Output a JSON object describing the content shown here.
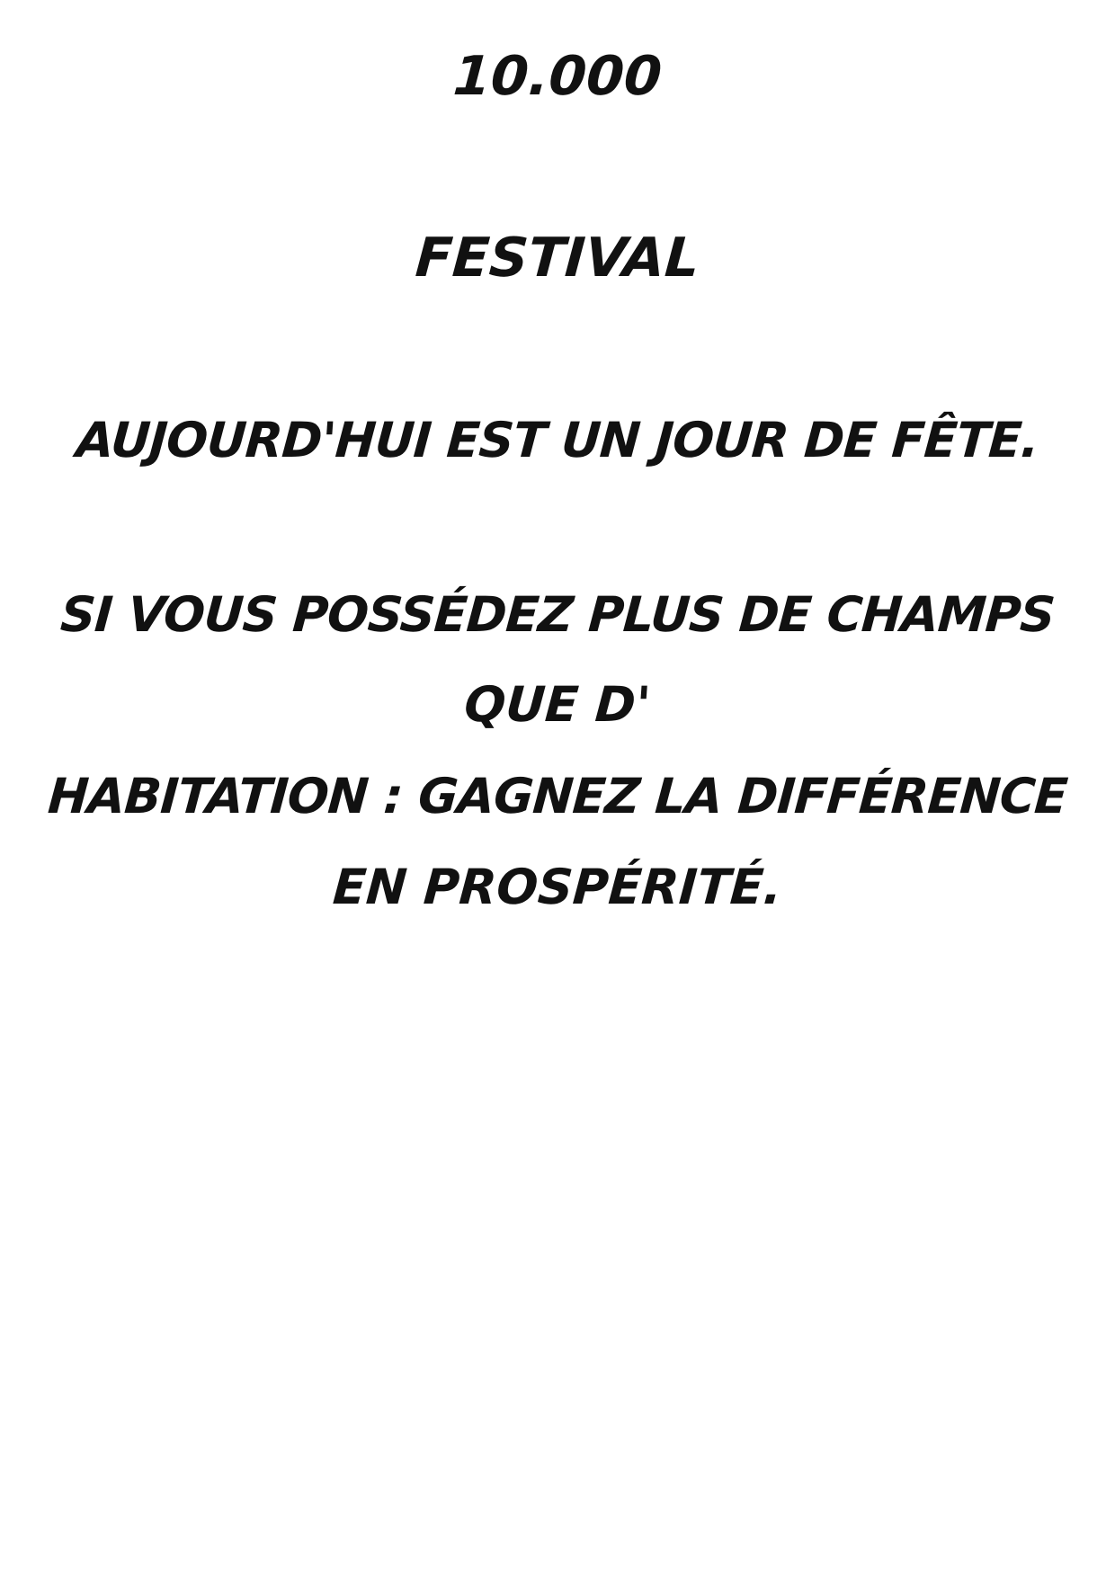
{
  "card": {
    "number": "10.000",
    "title": "FESTIVAL",
    "subtitle": "AUJOURD'HUI EST UN JOUR DE FÊTE.",
    "description_lines": [
      "SI VOUS POSSÉDEZ PLUS DE CHAMPS",
      "QUE D'",
      "HABITATION : GAGNEZ LA DIFFÉRENCE",
      "EN PROSPÉRITÉ."
    ]
  },
  "colors": {
    "text": "#111111",
    "background": "#ffffff"
  }
}
